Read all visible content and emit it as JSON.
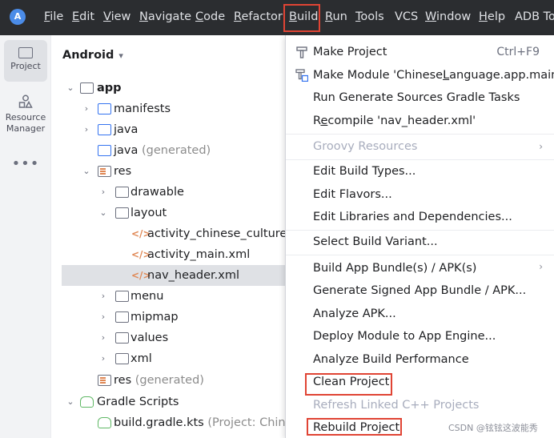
{
  "menubar": {
    "items": [
      {
        "mnemonic": "F",
        "rest": "ile"
      },
      {
        "mnemonic": "E",
        "rest": "dit"
      },
      {
        "mnemonic": "V",
        "rest": "iew"
      },
      {
        "mnemonic": "N",
        "rest": "avigate"
      },
      {
        "mnemonic": "C",
        "rest": "ode"
      },
      {
        "mnemonic": "R",
        "rest": "efactor"
      },
      {
        "mnemonic": "B",
        "rest": "uild"
      },
      {
        "mnemonic": "R",
        "rest": "un"
      },
      {
        "mnemonic": "T",
        "rest": "ools"
      },
      {
        "mnemonic": "",
        "rest": "VCS"
      },
      {
        "mnemonic": "W",
        "rest": "indow"
      },
      {
        "mnemonic": "H",
        "rest": "elp"
      },
      {
        "mnemonic": "",
        "rest": "ADB To"
      }
    ]
  },
  "toolstrip": {
    "project_label": "Project",
    "resource_label_1": "Resource",
    "resource_label_2": "Manager",
    "more_label": "•••"
  },
  "tree": {
    "header": "Android",
    "rows": [
      {
        "label": "app",
        "suffix": ""
      },
      {
        "label": "manifests",
        "suffix": ""
      },
      {
        "label": "java",
        "suffix": ""
      },
      {
        "label": "java",
        "suffix": "(generated)"
      },
      {
        "label": "res",
        "suffix": ""
      },
      {
        "label": "drawable",
        "suffix": ""
      },
      {
        "label": "layout",
        "suffix": ""
      },
      {
        "label": "activity_chinese_culture.xml",
        "suffix": ""
      },
      {
        "label": "activity_main.xml",
        "suffix": ""
      },
      {
        "label": "nav_header.xml",
        "suffix": ""
      },
      {
        "label": "menu",
        "suffix": ""
      },
      {
        "label": "mipmap",
        "suffix": ""
      },
      {
        "label": "values",
        "suffix": ""
      },
      {
        "label": "xml",
        "suffix": ""
      },
      {
        "label": "res",
        "suffix": "(generated)"
      },
      {
        "label": "Gradle Scripts",
        "suffix": ""
      },
      {
        "label": "build.gradle.kts",
        "suffix": "(Project: Chinese_"
      }
    ]
  },
  "build_menu": {
    "make_project": "Make Project",
    "make_project_shortcut": "Ctrl+F9",
    "make_module_pre": "Make Module 'Chinese",
    "make_module_ul": "L",
    "make_module_post": "anguage.app.main'",
    "run_generate": "Run Generate Sources Gradle Tasks",
    "recompile_pre": "R",
    "recompile_ul": "e",
    "recompile_post": "compile 'nav_header.xml'",
    "groovy": "Groovy Resources",
    "edit_build_types": "Edit Build Types...",
    "edit_flavors": "Edit Flavors...",
    "edit_libraries": "Edit Libraries and Dependencies...",
    "select_variant": "Select Build Variant...",
    "build_bundle": "Build App Bundle(s) / APK(s)",
    "generate_signed": "Generate Signed App Bundle / APK...",
    "analyze_apk": "Analyze APK...",
    "deploy_module": "Deploy Module to App Engine...",
    "analyze_perf": "Analyze Build Performance",
    "clean_project": "Clean Project",
    "refresh_linked": "Refresh Linked C++ Projects",
    "rebuild_project": "Rebuild Project"
  },
  "watermark": "CSDN @铉铉这波能秀",
  "colors": {
    "highlight_box": "#e04434",
    "menubar_bg": "#2b2d30",
    "accent_blue": "#3574f0"
  }
}
